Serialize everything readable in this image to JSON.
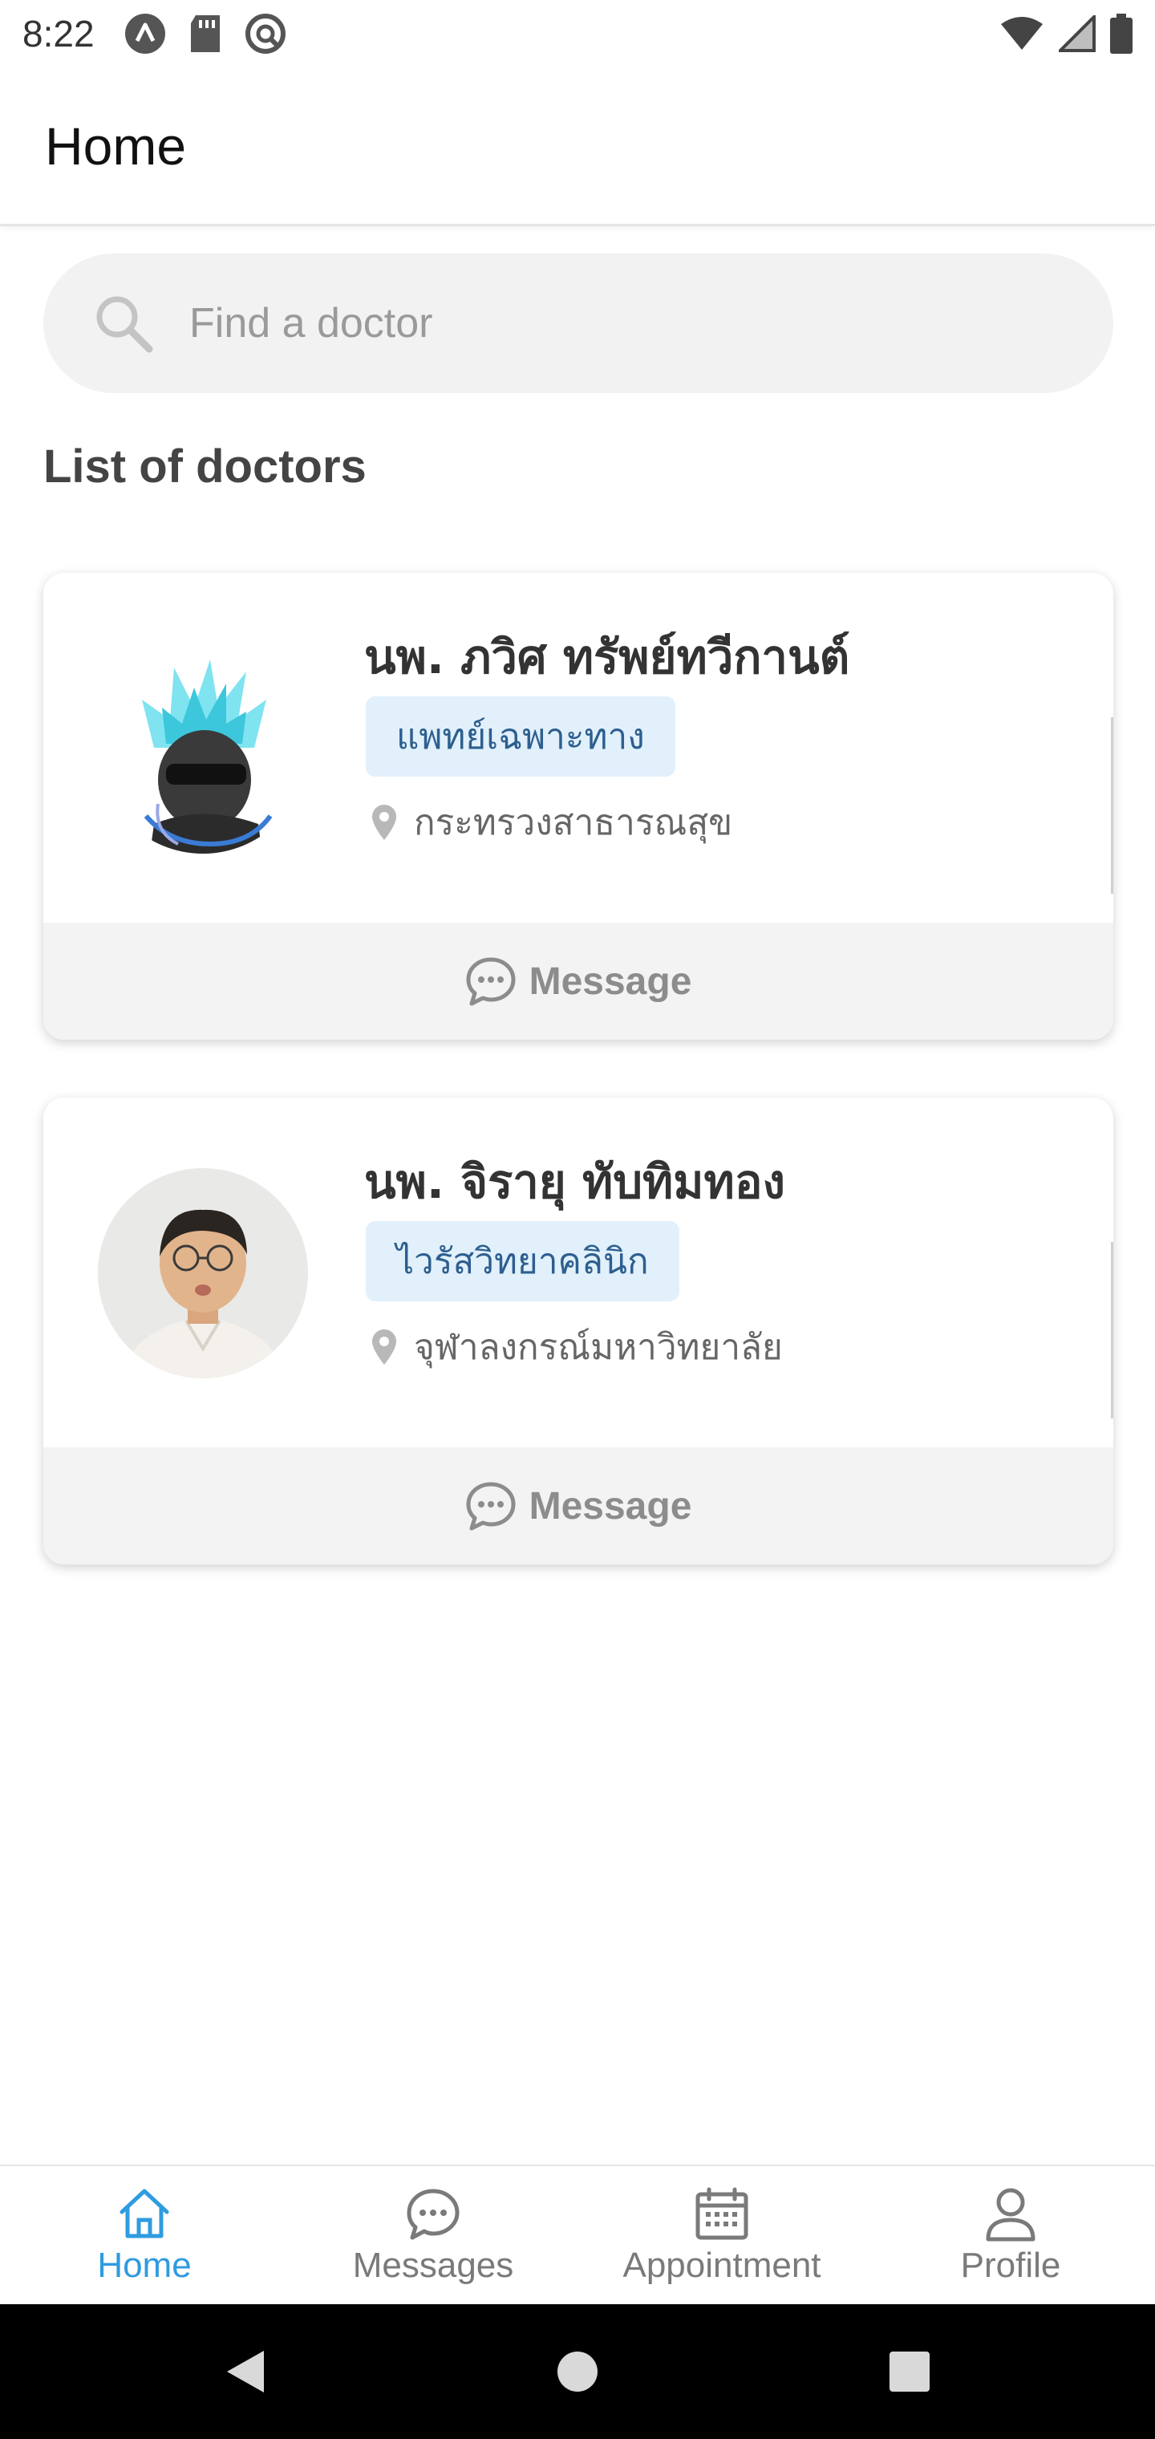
{
  "status_bar": {
    "time": "8:22"
  },
  "header": {
    "title": "Home"
  },
  "search": {
    "placeholder": "Find a doctor"
  },
  "section": {
    "title": "List of doctors"
  },
  "doctors": [
    {
      "name": "นพ. ภวิศ ทรัพย์ทวีกานต์",
      "specialty": "แพทย์เฉพาะทาง",
      "location": "กระทรวงสาธารณสุข",
      "message_label": "Message"
    },
    {
      "name": "นพ. จิรายุ ทับทิมทอง",
      "specialty": "ไวรัสวิทยาคลินิก",
      "location": "จุฬาลงกรณ์มหาวิทยาลัย",
      "message_label": "Message"
    }
  ],
  "bottom_nav": {
    "items": [
      {
        "label": "Home",
        "icon": "home-icon",
        "active": true
      },
      {
        "label": "Messages",
        "icon": "chat-icon",
        "active": false
      },
      {
        "label": "Appointment",
        "icon": "calendar-icon",
        "active": false
      },
      {
        "label": "Profile",
        "icon": "person-icon",
        "active": false
      }
    ]
  },
  "colors": {
    "accent": "#2f9be0",
    "badge_bg": "#e1f0fb",
    "badge_text": "#2d5f8f",
    "inactive": "#7a7a7a"
  }
}
